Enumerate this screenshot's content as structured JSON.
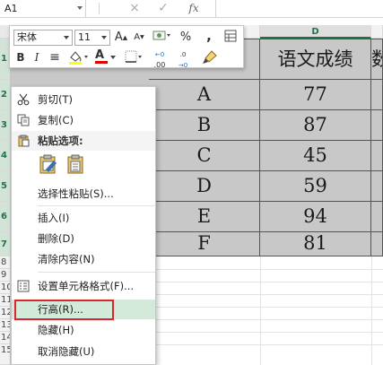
{
  "formula_bar": {
    "name_box": "A1",
    "cancel_icon": "×",
    "enter_icon": "✓",
    "fx_label": "fx"
  },
  "columns": {
    "selected_header": "D"
  },
  "rows": {
    "visible": [
      "1",
      "2",
      "3",
      "4",
      "5",
      "6",
      "7",
      "8",
      "9",
      "10",
      "11",
      "12",
      "13",
      "14",
      "15"
    ]
  },
  "table": {
    "header": "语文成绩",
    "next_header_fragment": "数",
    "students": [
      "A",
      "B",
      "C",
      "D",
      "E",
      "F"
    ],
    "scores": [
      "77",
      "87",
      "45",
      "59",
      "94",
      "81"
    ]
  },
  "mini_toolbar": {
    "font_name": "宋体",
    "font_size": "11",
    "grow_font": "A",
    "shrink_font": "A",
    "percent": "%",
    "comma": ",",
    "bold": "B",
    "italic": "I",
    "align_center": "≡",
    "font_color_letter": "A",
    "increase_decimal": ".00",
    "decrease_decimal": ".0"
  },
  "context_menu": {
    "cut": "剪切(T)",
    "copy": "复制(C)",
    "paste_options": "粘贴选项:",
    "paste_special": "选择性粘贴(S)...",
    "insert": "插入(I)",
    "delete": "删除(D)",
    "clear_contents": "清除内容(N)",
    "format_cells": "设置单元格格式(F)...",
    "row_height": "行高(R)...",
    "hide": "隐藏(H)",
    "unhide": "取消隐藏(U)"
  },
  "colors": {
    "accent": "#217346",
    "selection_fill": "#c8c8c8",
    "menu_hover": "#d3eadb",
    "highlight_box": "#d9252c",
    "font_color_bar": "#e00000",
    "fill_color_bar": "#ffff00"
  }
}
